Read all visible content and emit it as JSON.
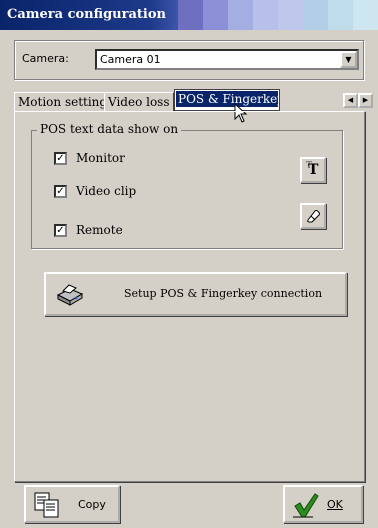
{
  "window": {
    "title": "Camera configuration"
  },
  "camera": {
    "label": "Camera:",
    "selected": "Camera 01"
  },
  "tabs": [
    {
      "label": "Motion setting"
    },
    {
      "label": "Video loss"
    },
    {
      "label": "POS & Fingerkey"
    }
  ],
  "pos": {
    "group_label": "POS text data show on",
    "options": [
      {
        "label": "Monitor",
        "checked": true
      },
      {
        "label": "Video clip",
        "checked": true
      },
      {
        "label": "Remote",
        "checked": true
      }
    ],
    "check_mark": "✓",
    "font_button_icon": "font-icon",
    "eraser_button_icon": "eraser-icon",
    "setup_button": "Setup POS & Fingerkey connection"
  },
  "footer": {
    "copy_label": "Copy",
    "ok_label": "OK"
  },
  "colors": {
    "title_start": "#0a246a",
    "title_end": "#cce6f0",
    "face": "#d4d0c8",
    "selection": "#0a246a",
    "ok_check": "#2e8b1e"
  }
}
